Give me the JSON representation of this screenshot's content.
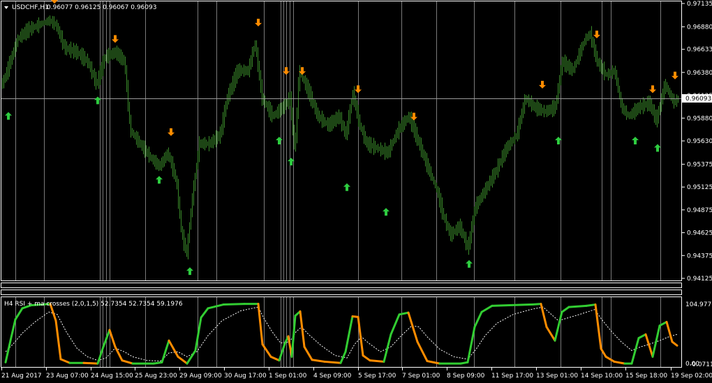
{
  "colors": {
    "background": "#000000",
    "foreground": "#ffffff",
    "candles": "#3a8a2a",
    "buy_arrow": "#2ecc40",
    "sell_arrow": "#ff8c00",
    "rsi_up": "#32cd32",
    "rsi_down": "#ff8c00",
    "signal_line": "#ffffff",
    "separator": "#7a7a7a"
  },
  "main_chart": {
    "title": "USDCHF,H1",
    "ohlc": "0.96077 0.96125 0.96067 0.96093",
    "current_price": "0.96093",
    "price_axis": [
      "0.97135",
      "0.96880",
      "0.96633",
      "0.96380",
      "0.96125",
      "0.95880",
      "0.95630",
      "0.95375",
      "0.95125",
      "0.94875",
      "0.94625",
      "0.94375",
      "0.94125"
    ],
    "time_axis": [
      "21 Aug 2017",
      "23 Aug 07:00",
      "24 Aug 15:00",
      "25 Aug 23:00",
      "29 Aug 09:00",
      "30 Aug 17:00",
      "1 Sep 01:00",
      "4 Sep 09:00",
      "5 Sep 17:00",
      "7 Sep 01:00",
      "8 Sep 09:00",
      "11 Sep 17:00",
      "13 Sep 01:00",
      "14 Sep 10:00",
      "15 Sep 18:00",
      "19 Sep 02:00"
    ]
  },
  "indicator": {
    "title": "H4 RSI + ma crosses (2,0,1,5) 52.7354 52.7354 59.1976",
    "axis_top": "104.9776",
    "axis_bottom": "-0.0711",
    "axis_zero": "0.00"
  },
  "chart_data": {
    "type": "line",
    "title": "USDCHF,H1",
    "ylim": [
      0.94125,
      0.97135
    ],
    "x": [
      "21 Aug 2017",
      "23 Aug 07:00",
      "24 Aug 15:00",
      "25 Aug 23:00",
      "29 Aug 09:00",
      "30 Aug 17:00",
      "1 Sep 01:00",
      "4 Sep 09:00",
      "5 Sep 17:00",
      "7 Sep 01:00",
      "8 Sep 09:00",
      "11 Sep 17:00",
      "13 Sep 01:00",
      "14 Sep 10:00",
      "15 Sep 18:00",
      "19 Sep 02:00"
    ],
    "series": [
      {
        "values": [
          0.9615,
          0.968,
          0.963,
          0.957,
          0.9445,
          0.964,
          0.961,
          0.96,
          0.956,
          0.9575,
          0.946,
          0.96,
          0.961,
          0.966,
          0.96,
          0.9605
        ]
      }
    ],
    "price_path": [
      [
        0,
        0.962
      ],
      [
        10,
        0.964
      ],
      [
        25,
        0.9675
      ],
      [
        40,
        0.9685
      ],
      [
        55,
        0.969
      ],
      [
        70,
        0.9695
      ],
      [
        80,
        0.969
      ],
      [
        92,
        0.9665
      ],
      [
        110,
        0.966
      ],
      [
        125,
        0.965
      ],
      [
        138,
        0.9625
      ],
      [
        150,
        0.9655
      ],
      [
        165,
        0.966
      ],
      [
        178,
        0.965
      ],
      [
        186,
        0.9575
      ],
      [
        200,
        0.956
      ],
      [
        215,
        0.9545
      ],
      [
        228,
        0.9535
      ],
      [
        240,
        0.955
      ],
      [
        252,
        0.952
      ],
      [
        260,
        0.946
      ],
      [
        267,
        0.944
      ],
      [
        275,
        0.95
      ],
      [
        285,
        0.956
      ],
      [
        300,
        0.956
      ],
      [
        315,
        0.957
      ],
      [
        325,
        0.961
      ],
      [
        340,
        0.964
      ],
      [
        355,
        0.964
      ],
      [
        365,
        0.967
      ],
      [
        375,
        0.961
      ],
      [
        390,
        0.959
      ],
      [
        405,
        0.96
      ],
      [
        415,
        0.961
      ],
      [
        422,
        0.955
      ],
      [
        428,
        0.964
      ],
      [
        440,
        0.962
      ],
      [
        455,
        0.959
      ],
      [
        470,
        0.958
      ],
      [
        485,
        0.959
      ],
      [
        495,
        0.957
      ],
      [
        505,
        0.9615
      ],
      [
        515,
        0.958
      ],
      [
        525,
        0.956
      ],
      [
        540,
        0.9555
      ],
      [
        555,
        0.955
      ],
      [
        570,
        0.9575
      ],
      [
        585,
        0.959
      ],
      [
        600,
        0.956
      ],
      [
        612,
        0.9535
      ],
      [
        625,
        0.951
      ],
      [
        635,
        0.948
      ],
      [
        645,
        0.946
      ],
      [
        658,
        0.947
      ],
      [
        670,
        0.9445
      ],
      [
        680,
        0.949
      ],
      [
        695,
        0.951
      ],
      [
        710,
        0.953
      ],
      [
        725,
        0.9555
      ],
      [
        740,
        0.957
      ],
      [
        752,
        0.961
      ],
      [
        765,
        0.96
      ],
      [
        780,
        0.9595
      ],
      [
        795,
        0.96
      ],
      [
        805,
        0.965
      ],
      [
        820,
        0.964
      ],
      [
        838,
        0.9675
      ],
      [
        845,
        0.968
      ],
      [
        855,
        0.965
      ],
      [
        868,
        0.9635
      ],
      [
        880,
        0.964
      ],
      [
        890,
        0.96
      ],
      [
        900,
        0.959
      ],
      [
        915,
        0.96
      ],
      [
        930,
        0.9605
      ],
      [
        940,
        0.9585
      ],
      [
        952,
        0.9625
      ],
      [
        965,
        0.9605
      ],
      [
        972,
        0.961
      ]
    ],
    "buy_signals": [
      [
        12,
        0.959
      ],
      [
        140,
        0.9607
      ],
      [
        228,
        0.952
      ],
      [
        272,
        0.942
      ],
      [
        400,
        0.9563
      ],
      [
        417,
        0.954
      ],
      [
        497,
        0.9512
      ],
      [
        553,
        0.9485
      ],
      [
        672,
        0.9428
      ],
      [
        800,
        0.9563
      ],
      [
        910,
        0.9563
      ],
      [
        942,
        0.9555
      ]
    ],
    "sell_signals": [
      [
        78,
        0.9718
      ],
      [
        165,
        0.9675
      ],
      [
        245,
        0.9573
      ],
      [
        370,
        0.9693
      ],
      [
        410,
        0.964
      ],
      [
        433,
        0.964
      ],
      [
        513,
        0.962
      ],
      [
        593,
        0.959
      ],
      [
        777,
        0.9625
      ],
      [
        855,
        0.968
      ],
      [
        935,
        0.962
      ],
      [
        967,
        0.9635
      ]
    ],
    "rsi_path": [
      [
        8,
        3
      ],
      [
        15,
        38
      ],
      [
        22,
        72
      ],
      [
        32,
        90
      ],
      [
        45,
        95
      ],
      [
        60,
        96
      ],
      [
        72,
        97
      ],
      [
        80,
        70
      ],
      [
        87,
        8
      ],
      [
        100,
        2
      ],
      [
        120,
        2
      ],
      [
        140,
        1
      ],
      [
        148,
        28
      ],
      [
        157,
        55
      ],
      [
        165,
        28
      ],
      [
        175,
        6
      ],
      [
        190,
        1
      ],
      [
        220,
        1
      ],
      [
        232,
        3
      ],
      [
        242,
        38
      ],
      [
        255,
        12
      ],
      [
        268,
        1
      ],
      [
        280,
        22
      ],
      [
        288,
        75
      ],
      [
        298,
        90
      ],
      [
        320,
        96
      ],
      [
        350,
        97
      ],
      [
        370,
        97
      ],
      [
        376,
        32
      ],
      [
        388,
        12
      ],
      [
        400,
        6
      ],
      [
        408,
        33
      ],
      [
        413,
        45
      ],
      [
        418,
        12
      ],
      [
        423,
        78
      ],
      [
        430,
        85
      ],
      [
        436,
        28
      ],
      [
        447,
        7
      ],
      [
        465,
        4
      ],
      [
        488,
        2
      ],
      [
        495,
        20
      ],
      [
        505,
        77
      ],
      [
        513,
        76
      ],
      [
        520,
        14
      ],
      [
        530,
        6
      ],
      [
        550,
        4
      ],
      [
        560,
        48
      ],
      [
        572,
        80
      ],
      [
        585,
        83
      ],
      [
        598,
        36
      ],
      [
        612,
        5
      ],
      [
        630,
        1
      ],
      [
        660,
        1
      ],
      [
        670,
        3
      ],
      [
        680,
        60
      ],
      [
        690,
        84
      ],
      [
        705,
        94
      ],
      [
        730,
        95
      ],
      [
        760,
        96
      ],
      [
        775,
        97
      ],
      [
        783,
        60
      ],
      [
        795,
        38
      ],
      [
        805,
        84
      ],
      [
        815,
        92
      ],
      [
        840,
        94
      ],
      [
        853,
        96
      ],
      [
        861,
        25
      ],
      [
        868,
        12
      ],
      [
        880,
        4
      ],
      [
        895,
        1
      ],
      [
        905,
        1
      ],
      [
        915,
        42
      ],
      [
        925,
        48
      ],
      [
        935,
        12
      ],
      [
        945,
        62
      ],
      [
        955,
        68
      ],
      [
        963,
        36
      ],
      [
        970,
        30
      ]
    ],
    "signal_path": [
      [
        8,
        20
      ],
      [
        20,
        34
      ],
      [
        32,
        50
      ],
      [
        50,
        68
      ],
      [
        70,
        84
      ],
      [
        82,
        80
      ],
      [
        95,
        52
      ],
      [
        110,
        26
      ],
      [
        125,
        12
      ],
      [
        140,
        6
      ],
      [
        152,
        10
      ],
      [
        165,
        26
      ],
      [
        178,
        20
      ],
      [
        190,
        12
      ],
      [
        210,
        6
      ],
      [
        230,
        5
      ],
      [
        242,
        18
      ],
      [
        255,
        20
      ],
      [
        268,
        12
      ],
      [
        282,
        20
      ],
      [
        298,
        46
      ],
      [
        318,
        70
      ],
      [
        345,
        86
      ],
      [
        370,
        92
      ],
      [
        378,
        74
      ],
      [
        390,
        52
      ],
      [
        402,
        34
      ],
      [
        415,
        36
      ],
      [
        424,
        52
      ],
      [
        432,
        60
      ],
      [
        442,
        48
      ],
      [
        460,
        30
      ],
      [
        480,
        14
      ],
      [
        497,
        10
      ],
      [
        508,
        32
      ],
      [
        518,
        44
      ],
      [
        528,
        34
      ],
      [
        545,
        20
      ],
      [
        560,
        28
      ],
      [
        575,
        46
      ],
      [
        590,
        62
      ],
      [
        600,
        60
      ],
      [
        612,
        44
      ],
      [
        630,
        24
      ],
      [
        650,
        12
      ],
      [
        670,
        8
      ],
      [
        682,
        24
      ],
      [
        695,
        46
      ],
      [
        712,
        66
      ],
      [
        735,
        80
      ],
      [
        760,
        88
      ],
      [
        778,
        92
      ],
      [
        788,
        82
      ],
      [
        800,
        70
      ],
      [
        812,
        74
      ],
      [
        830,
        80
      ],
      [
        852,
        88
      ],
      [
        862,
        72
      ],
      [
        875,
        54
      ],
      [
        890,
        36
      ],
      [
        905,
        22
      ],
      [
        918,
        28
      ],
      [
        930,
        32
      ],
      [
        945,
        38
      ],
      [
        958,
        44
      ],
      [
        970,
        48
      ]
    ]
  }
}
